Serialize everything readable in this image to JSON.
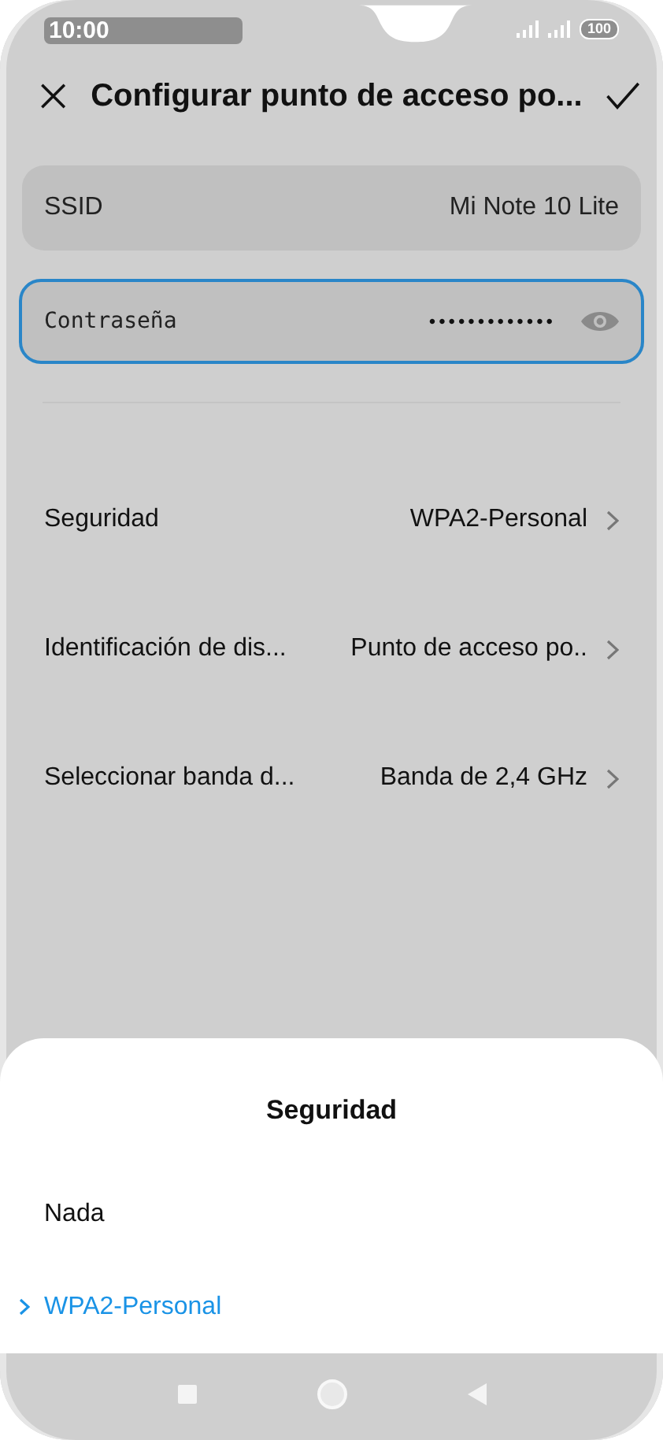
{
  "status_bar": {
    "time": "10:00",
    "battery": "100"
  },
  "header": {
    "title": "Configurar punto de acceso po..."
  },
  "ssid": {
    "label": "SSID",
    "value": "Mi Note 10 Lite"
  },
  "password": {
    "label": "Contraseña",
    "value": "•••••••••••••",
    "focused": true
  },
  "settings": [
    {
      "label": "Seguridad",
      "value": "WPA2-Personal"
    },
    {
      "label": "Identificación de dis...",
      "value": "Punto de acceso po.."
    },
    {
      "label": "Seleccionar banda d...",
      "value": "Banda de 2,4 GHz"
    }
  ],
  "sheet": {
    "title": "Seguridad",
    "options": [
      {
        "label": "Nada",
        "selected": false
      },
      {
        "label": "WPA2-Personal",
        "selected": true
      }
    ]
  }
}
